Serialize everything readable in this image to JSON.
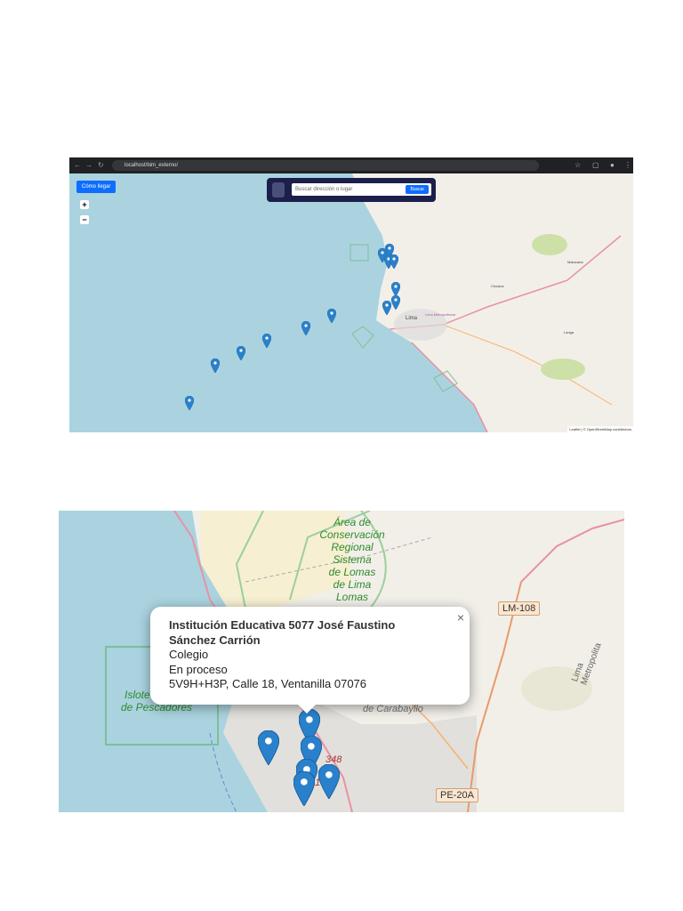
{
  "browser": {
    "url": "localhost/bim_externo/"
  },
  "map_app": {
    "how_to_button": "Cómo llegar",
    "zoom_in": "+",
    "zoom_out": "−",
    "search": {
      "placeholder": "Buscar dirección o lugar",
      "button": "Buscar"
    },
    "attribution": "Leaflet | © OpenStreetMap contributors",
    "labels": {
      "lima": "Lima",
      "lima_metro": "Lima Metropolitana",
      "chosica": "Chosica",
      "matucana": "Matucana",
      "langa": "Langa"
    }
  },
  "zoomed_map": {
    "area_label": [
      "Área de",
      "Conservación",
      "Regional",
      "Sistema",
      "de Lomas",
      "de Lima",
      "Lomas"
    ],
    "islote_label": [
      "Islote",
      "de Pescadores"
    ],
    "carabayllo_label": "de Carabayllo",
    "road_lm108": "LM-108",
    "road_pe20a": "PE-20A",
    "road_348": "348",
    "road_31": "31",
    "lima_metro_label": "Lima Metropolita",
    "popup": {
      "title": "Institución Educativa 5077 José Faustino Sánchez Carrión",
      "type": "Colegio",
      "status": "En proceso",
      "address": "5V9H+H3P, Calle 18, Ventanilla 07076",
      "close": "×"
    }
  },
  "colors": {
    "marker": "#2a81cb",
    "primary": "#0d6efd",
    "search_bg": "#1b1f4b"
  }
}
